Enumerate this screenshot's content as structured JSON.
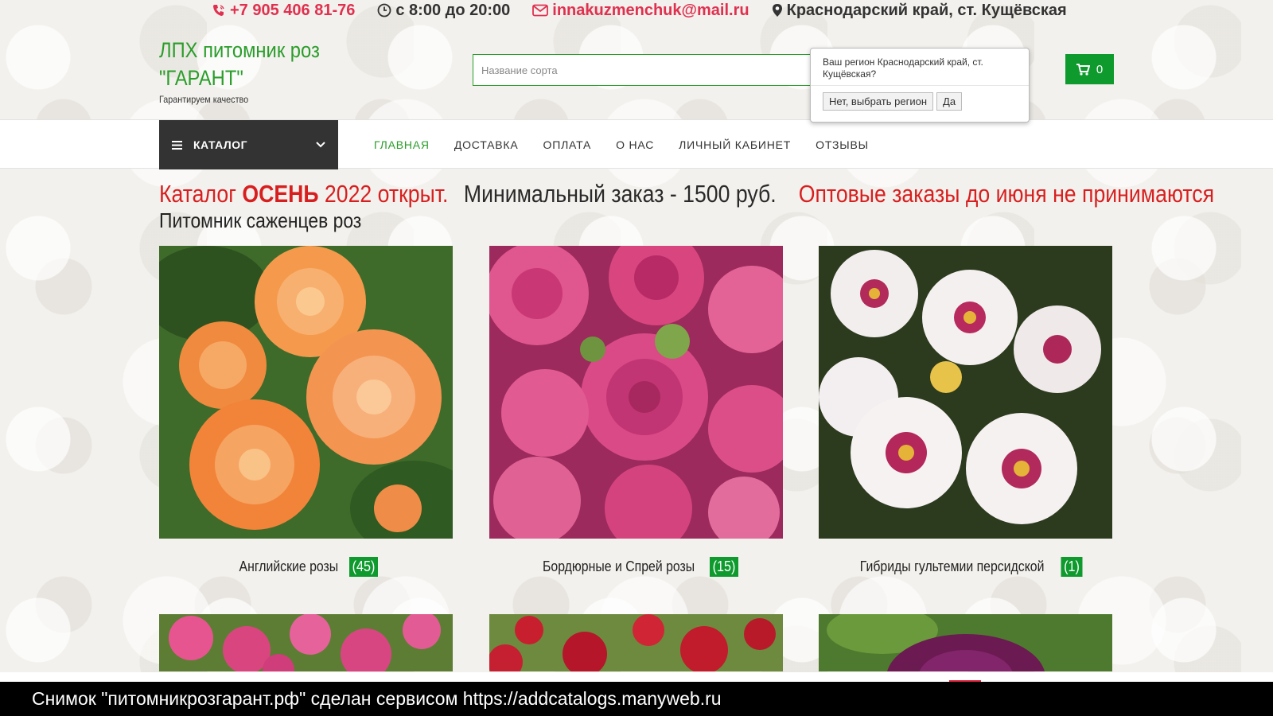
{
  "topbar": {
    "phone": "+7 905 406 81-76",
    "hours": "с 8:00 до 20:00",
    "email": "innakuzmenchuk@mail.ru",
    "location": "Краснодарский край, ст. Кущёвская"
  },
  "header": {
    "logo_title": "ЛПХ питомник роз \"ГАРАНТ\"",
    "logo_tagline": "Гарантируем качество",
    "search_placeholder": "Название сорта",
    "cart_count": "0"
  },
  "region_popup": {
    "question": "Ваш регион Краснодарский край, ст. Кущёвская?",
    "no_button": "Нет, выбрать регион",
    "yes_button": "Да"
  },
  "nav": {
    "catalog_label": "КАТАЛОГ",
    "links": [
      {
        "label": "ГЛАВНАЯ",
        "active": true
      },
      {
        "label": "ДОСТАВКА",
        "active": false
      },
      {
        "label": "ОПЛАТА",
        "active": false
      },
      {
        "label": "О НАС",
        "active": false
      },
      {
        "label": "ЛИЧНЫЙ КАБИНЕТ",
        "active": false
      },
      {
        "label": "ОТЗЫВЫ",
        "active": false
      }
    ]
  },
  "announcement": {
    "part1": "Каталог ",
    "part1_bold": "ОСЕНЬ",
    "part1_end": " 2022 открыт.",
    "part2": "Минимальный заказ - 1500 руб.",
    "part3": "Оптовые заказы до июня не принимаются"
  },
  "subtitle": "Питомник саженцев роз",
  "categories": [
    {
      "name": "Английские розы",
      "count": "(45)"
    },
    {
      "name": "Бордюрные и Спрей розы",
      "count": "(15)"
    },
    {
      "name": "Гибриды гультемии персидской",
      "count": "(1)"
    }
  ],
  "footer_caption": "Снимок \"питомникрозгарант.рф\" сделан сервисом https://addcatalogs.manyweb.ru",
  "colors": {
    "brand_green": "#2a9d2a",
    "button_green": "#0f9a2e",
    "accent_red": "#d81f1f",
    "contact_red": "#e0304f"
  }
}
